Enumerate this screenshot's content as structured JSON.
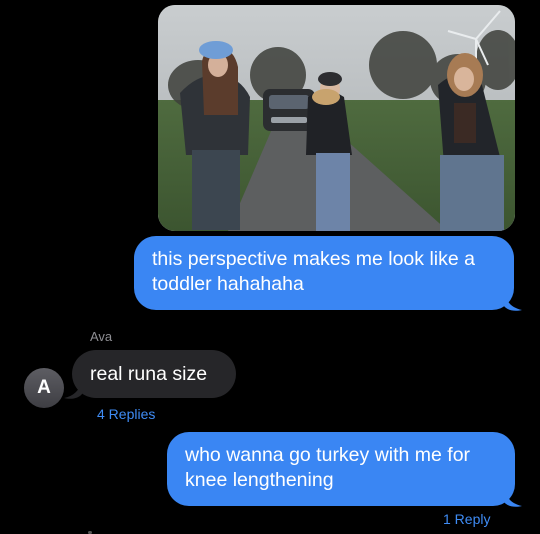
{
  "conversation": {
    "photo": {
      "description_icon": "photo-attachment"
    },
    "messages": [
      {
        "direction": "outgoing",
        "text": "this perspective makes me look like a\ntoddler hahahaha"
      },
      {
        "direction": "incoming",
        "sender": "Ava",
        "avatar_initial": "A",
        "text": "real runa size",
        "replies": "4 Replies"
      },
      {
        "direction": "outgoing",
        "text": "who wanna go turkey with me for\nknee lengthening",
        "replies": "1 Reply"
      }
    ]
  },
  "colors": {
    "background": "#000000",
    "outgoing_bubble": "#3A86F3",
    "incoming_bubble": "#262629",
    "reply_link": "#3F8CF5"
  }
}
